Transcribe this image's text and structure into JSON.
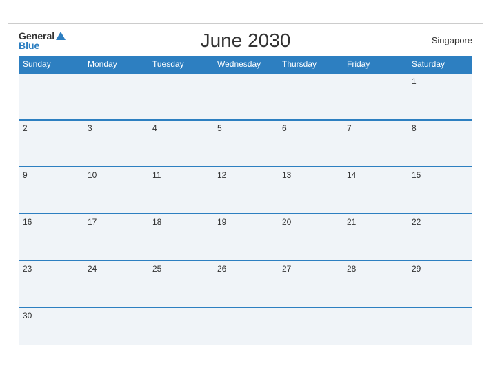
{
  "header": {
    "logo_general": "General",
    "logo_blue": "Blue",
    "title": "June 2030",
    "location": "Singapore"
  },
  "weekdays": [
    "Sunday",
    "Monday",
    "Tuesday",
    "Wednesday",
    "Thursday",
    "Friday",
    "Saturday"
  ],
  "weeks": [
    [
      null,
      null,
      null,
      null,
      null,
      null,
      1
    ],
    [
      2,
      3,
      4,
      5,
      6,
      7,
      8
    ],
    [
      9,
      10,
      11,
      12,
      13,
      14,
      15
    ],
    [
      16,
      17,
      18,
      19,
      20,
      21,
      22
    ],
    [
      23,
      24,
      25,
      26,
      27,
      28,
      29
    ],
    [
      30,
      null,
      null,
      null,
      null,
      null,
      null
    ]
  ],
  "colors": {
    "header_bg": "#2d7fc1",
    "cell_bg": "#f0f4f8",
    "accent": "#2d7fc1"
  }
}
